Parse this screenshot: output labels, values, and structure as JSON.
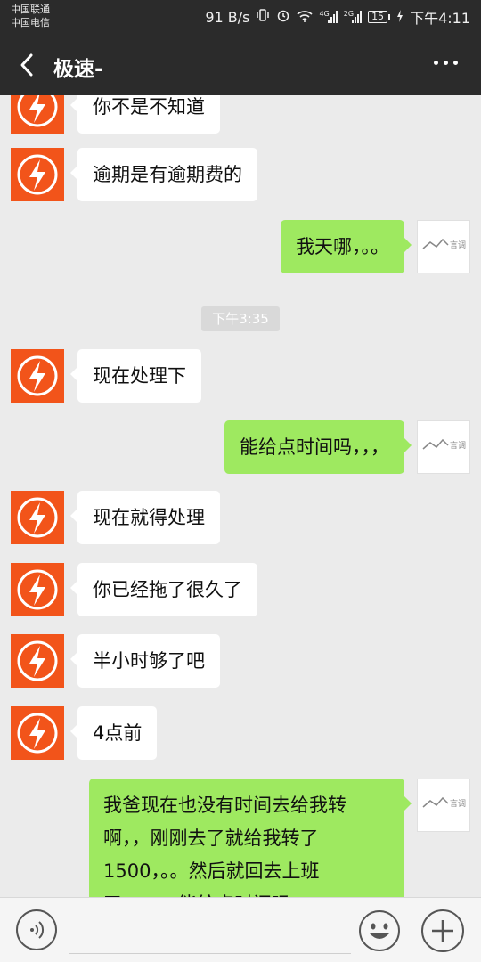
{
  "status_bar": {
    "carrier1": "中国联通",
    "carrier2": "中国电信",
    "net_speed": "91 B/s",
    "tag_4g": "4G",
    "tag_2g": "2G",
    "battery": "15",
    "time": "下午4:11"
  },
  "header": {
    "back_icon": "chevron-left-icon",
    "title": "极速-",
    "more_icon": "more-dots-icon"
  },
  "messages": [
    {
      "side": "left",
      "text": "你不是不知道"
    },
    {
      "side": "left",
      "text": "逾期是有逾期费的"
    },
    {
      "side": "right",
      "text": "我天哪，。。"
    },
    {
      "type": "time",
      "text": "下午3:35"
    },
    {
      "side": "left",
      "text": "现在处理下"
    },
    {
      "side": "right",
      "text": "能给点时间吗，，，"
    },
    {
      "side": "left",
      "text": "现在就得处理"
    },
    {
      "side": "left",
      "text": "你已经拖了很久了"
    },
    {
      "side": "left",
      "text": "半小时够了吧"
    },
    {
      "side": "left",
      "text": "4点前"
    },
    {
      "side": "right",
      "text": "我爸现在也没有时间去给我转啊，，刚刚去了就给我转了1500，。。然后就回去上班了，，，，，能给点时间吗"
    }
  ],
  "avatars": {
    "left_icon": "lightning-logo-icon",
    "right_icon": "landscape-logo-icon",
    "right_text": "言调",
    "left_color": "#f2541a"
  },
  "input_bar": {
    "voice_icon": "voice-icon",
    "emoji_icon": "emoji-icon",
    "plus_icon": "plus-icon",
    "input_value": ""
  },
  "colors": {
    "header_bg": "#2b2b2b",
    "chat_bg": "#ebebeb",
    "sent_bubble": "#9ee960",
    "received_bubble": "#ffffff"
  }
}
